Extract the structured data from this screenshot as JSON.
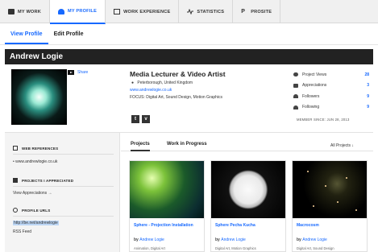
{
  "top_tabs": [
    {
      "label": "MY WORK",
      "icon": "briefcase-icon"
    },
    {
      "label": "MY PROFILE",
      "icon": "user-icon"
    },
    {
      "label": "WORK EXPERIENCE",
      "icon": "document-icon"
    },
    {
      "label": "STATISTICS",
      "icon": "pulse-icon"
    },
    {
      "label": "PROSITE",
      "icon": "prosite-icon"
    }
  ],
  "sub_tabs": [
    {
      "label": "View Profile"
    },
    {
      "label": "Edit Profile"
    }
  ],
  "profile": {
    "name": "Andrew Logie",
    "share": "Share",
    "title": "Media Lecturer & Video Artist",
    "location": "Peterborough, United Kingdom",
    "website": "www.andrewlogie.co.uk",
    "focus": "FOCUS: Digital Art, Sound Design, Motion Graphics",
    "social": [
      "t",
      "v"
    ],
    "member_since": "MEMBER SINCE: JUN 28, 2013"
  },
  "stats": [
    {
      "label": "Project Views",
      "value": "28",
      "icon": "eye-icon"
    },
    {
      "label": "Appreciations",
      "value": "3",
      "icon": "thumbs-up-icon"
    },
    {
      "label": "Followers",
      "value": "9",
      "icon": "followers-icon"
    },
    {
      "label": "Following",
      "value": "9",
      "icon": "following-icon"
    }
  ],
  "sidebar": {
    "web_references_heading": "WEB REFERENCES",
    "web_reference": "• www.andrewlogie.co.uk",
    "appreciated_heading": "PROJECTS I APPRECIATED",
    "view_appreciations": "View Appreciations →",
    "profile_urls_heading": "PROFILE URLS",
    "profile_url": "http://be.net/andrewlogie",
    "rss_feed": "RSS Feed"
  },
  "projects": {
    "tabs": [
      "Projects",
      "Work in Progress"
    ],
    "filter": "All Projects  ↓",
    "items": [
      {
        "title": "Sphere - Projection Installation",
        "by": "by",
        "author": "Andrew Logie",
        "tags": "Animation, Digital Art"
      },
      {
        "title": "Sphere Pecha Kucha",
        "by": "by",
        "author": "Andrew Logie",
        "tags": "Digital Art, Motion Graphics"
      },
      {
        "title": "Macrocosm",
        "by": "by",
        "author": "Andrew Logie",
        "tags": "Digital Art, Sound Design"
      }
    ]
  },
  "colors": {
    "accent": "#1769ff",
    "name_bar": "#222222"
  }
}
